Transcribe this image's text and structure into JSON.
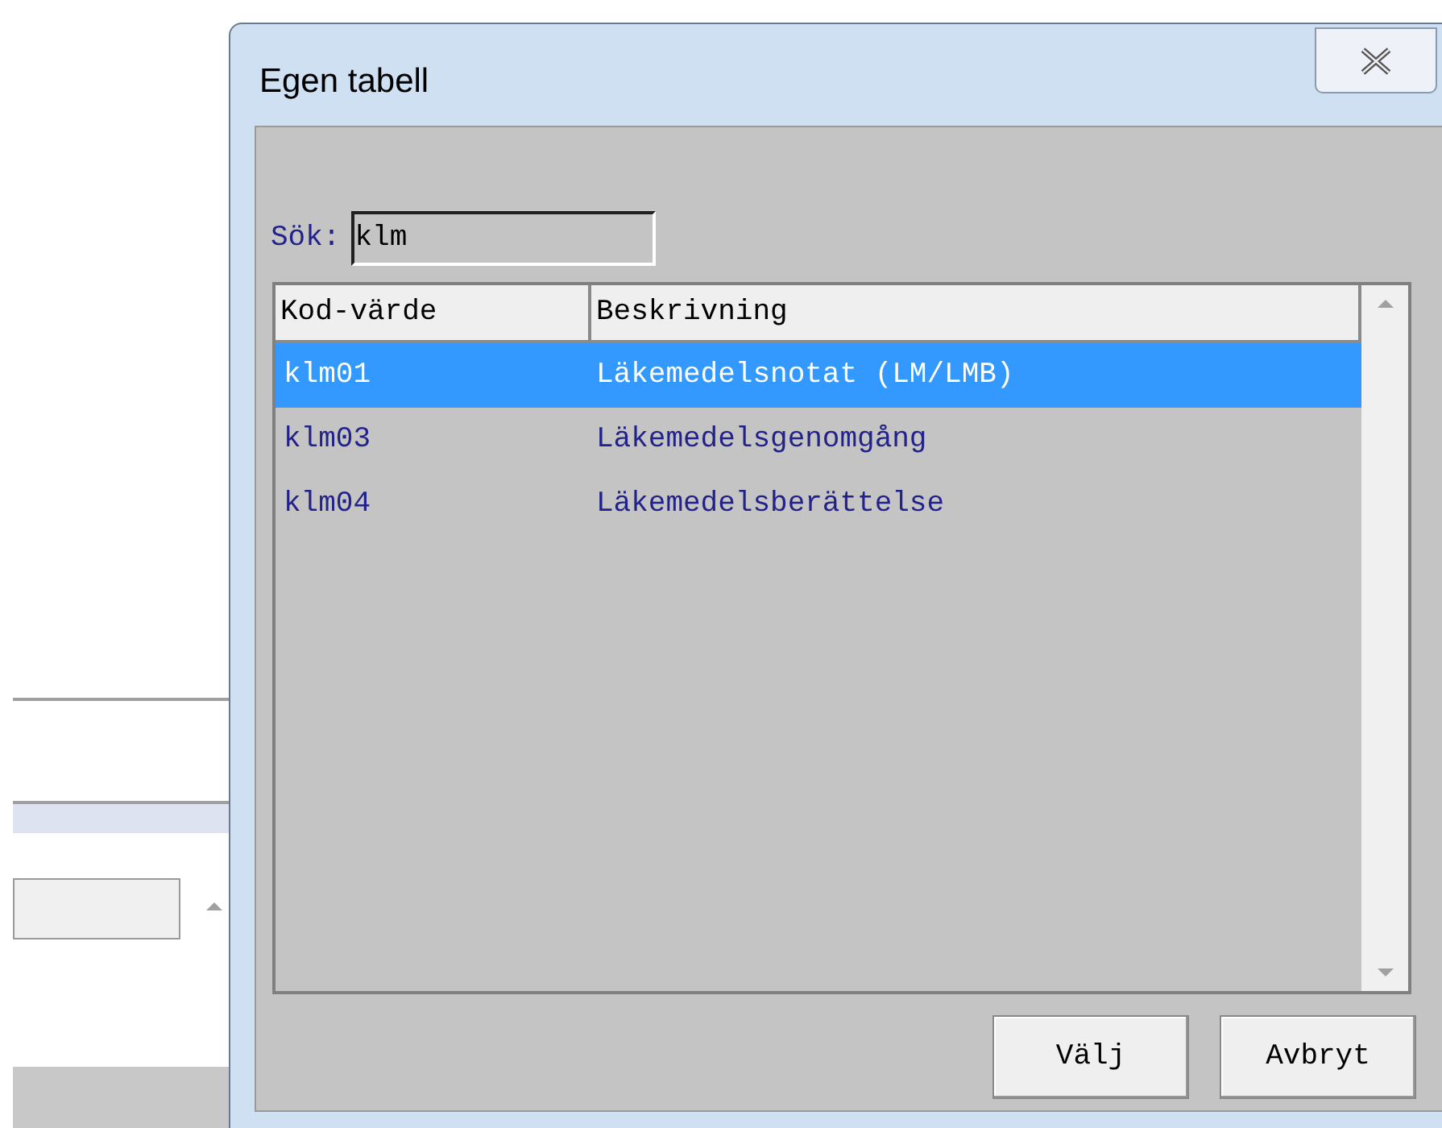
{
  "window": {
    "title": "Egen tabell"
  },
  "search": {
    "label": "Sök:",
    "value": "klm"
  },
  "table": {
    "columns": [
      "Kod-värde",
      "Beskrivning"
    ],
    "rows": [
      {
        "code": "klm01",
        "description": "Läkemedelsnotat (LM/LMB)",
        "selected": true
      },
      {
        "code": "klm03",
        "description": "Läkemedelsgenomgång",
        "selected": false
      },
      {
        "code": "klm04",
        "description": "Läkemedelsberättelse",
        "selected": false
      }
    ]
  },
  "buttons": [
    "Välj",
    "Avbryt"
  ]
}
